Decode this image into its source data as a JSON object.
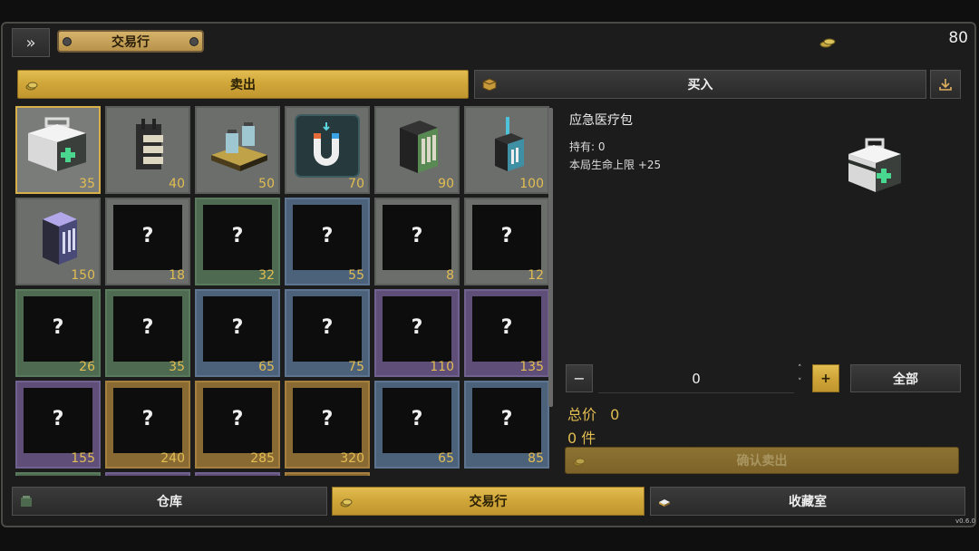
{
  "header": {
    "expand_icon": "»",
    "title": "交易行",
    "coin_icon": "coins-icon",
    "coin_value": "80"
  },
  "mode_tabs": {
    "sell_label": "卖出",
    "buy_label": "买入",
    "download_icon": "download-icon"
  },
  "grid": {
    "items": [
      {
        "name": "应急医疗包",
        "price": "35",
        "rarity": "gray",
        "known": true,
        "selected": true,
        "icon": "medkit-icon"
      },
      {
        "name": "",
        "price": "40",
        "rarity": "gray",
        "known": true,
        "selected": false,
        "icon": "vest-icon"
      },
      {
        "name": "",
        "price": "50",
        "rarity": "gray",
        "known": true,
        "selected": false,
        "icon": "device-icon"
      },
      {
        "name": "",
        "price": "70",
        "rarity": "gray",
        "known": true,
        "selected": false,
        "icon": "magnet-icon"
      },
      {
        "name": "",
        "price": "90",
        "rarity": "gray",
        "known": true,
        "selected": false,
        "icon": "battery-icon"
      },
      {
        "name": "",
        "price": "100",
        "rarity": "gray",
        "known": true,
        "selected": false,
        "icon": "radio-icon"
      },
      {
        "name": "",
        "price": "150",
        "rarity": "gray",
        "known": true,
        "selected": false,
        "icon": "cell-icon"
      },
      {
        "name": "",
        "price": "18",
        "rarity": "gray",
        "known": false
      },
      {
        "name": "",
        "price": "32",
        "rarity": "green",
        "known": false
      },
      {
        "name": "",
        "price": "55",
        "rarity": "blue",
        "known": false
      },
      {
        "name": "",
        "price": "8",
        "rarity": "gray",
        "known": false
      },
      {
        "name": "",
        "price": "12",
        "rarity": "gray",
        "known": false
      },
      {
        "name": "",
        "price": "26",
        "rarity": "green",
        "known": false
      },
      {
        "name": "",
        "price": "35",
        "rarity": "green",
        "known": false
      },
      {
        "name": "",
        "price": "65",
        "rarity": "blue",
        "known": false
      },
      {
        "name": "",
        "price": "75",
        "rarity": "blue",
        "known": false
      },
      {
        "name": "",
        "price": "110",
        "rarity": "purple",
        "known": false
      },
      {
        "name": "",
        "price": "135",
        "rarity": "purple",
        "known": false
      },
      {
        "name": "",
        "price": "155",
        "rarity": "purple",
        "known": false
      },
      {
        "name": "",
        "price": "240",
        "rarity": "gold",
        "known": false
      },
      {
        "name": "",
        "price": "285",
        "rarity": "gold",
        "known": false
      },
      {
        "name": "",
        "price": "320",
        "rarity": "gold",
        "known": false
      },
      {
        "name": "",
        "price": "65",
        "rarity": "blue",
        "known": false
      },
      {
        "name": "",
        "price": "85",
        "rarity": "blue",
        "known": false
      }
    ],
    "unknown_mark": "?"
  },
  "detail": {
    "item_name": "应急医疗包",
    "owned": "持有: 0",
    "effect": "本局生命上限 +25"
  },
  "quantity": {
    "minus": "−",
    "value": "0",
    "plus": "+",
    "all_label": "全部"
  },
  "summary": {
    "total_label": "总价",
    "total_value": "0",
    "count_text": "0 件",
    "confirm_label": "确认卖出"
  },
  "bottom_nav": {
    "warehouse": "仓库",
    "market": "交易行",
    "collection": "收藏室"
  },
  "version": "v0.6.0"
}
